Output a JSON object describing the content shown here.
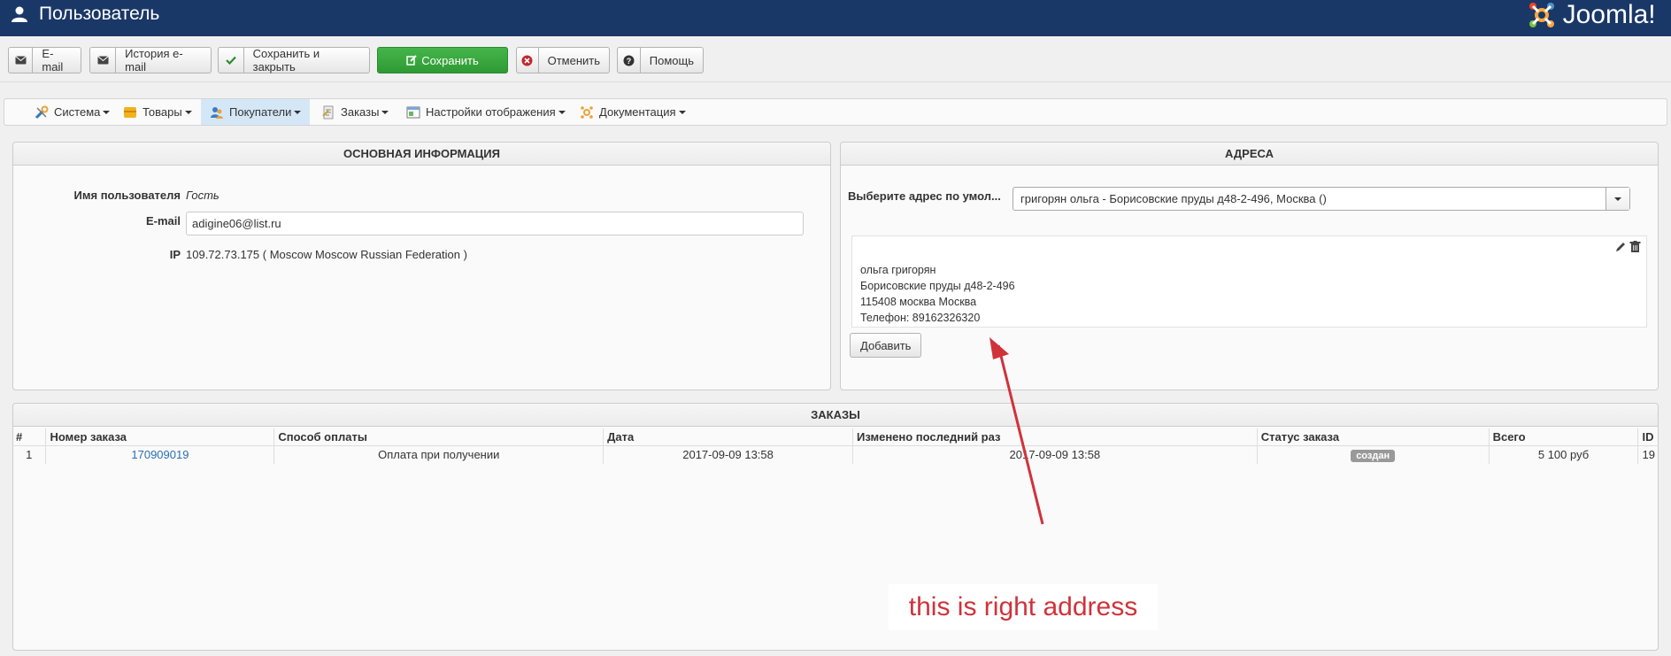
{
  "header": {
    "title": "Пользователь",
    "logo_text": "Joomla!",
    "logo_sup": "®"
  },
  "toolbar": {
    "email": "E-mail",
    "email_history": "История e-mail",
    "save_close": "Сохранить и закрыть",
    "save": "Сохранить",
    "cancel": "Отменить",
    "help": "Помощь"
  },
  "menu": {
    "items": [
      {
        "label": "Система"
      },
      {
        "label": "Товары"
      },
      {
        "label": "Покупатели"
      },
      {
        "label": "Заказы"
      },
      {
        "label": "Настройки отображения"
      },
      {
        "label": "Документация"
      }
    ]
  },
  "basic": {
    "title": "ОСНОВНАЯ ИНФОРМАЦИЯ",
    "username_label": "Имя пользователя",
    "username_value": "Гость",
    "email_label": "E-mail",
    "email_value": "adigine06@list.ru",
    "ip_label": "IP",
    "ip_value": "109.72.73.175 ( Moscow Moscow Russian Federation )"
  },
  "addresses": {
    "title": "АДРЕСА",
    "select_label": "Выберите адрес по умол...",
    "select_value": "григорян ольга - Борисовские пруды д48-2-496, Москва ()",
    "lines": [
      "ольга григорян",
      "Борисовские пруды д48-2-496",
      "115408 москва Москва",
      "Телефон: 89162326320"
    ],
    "add_button": "Добавить"
  },
  "orders": {
    "title": "ЗАКАЗЫ",
    "columns": [
      "#",
      "Номер заказа",
      "Способ оплаты",
      "Дата",
      "Изменено последний раз",
      "Статус заказа",
      "Всего",
      "ID"
    ],
    "rows": [
      {
        "num": "1",
        "order_number": "170909019",
        "payment": "Оплата при получении",
        "date": "2017-09-09 13:58",
        "modified": "2017-09-09 13:58",
        "status": "создан",
        "total": "5 100 руб",
        "id": "19"
      }
    ]
  },
  "annotation": {
    "text": "this is right address"
  },
  "colors": {
    "header_bg": "#1a3867",
    "save_green": "#3aa840",
    "annotation_red": "#d0323a",
    "link_blue": "#2a6eb3"
  }
}
